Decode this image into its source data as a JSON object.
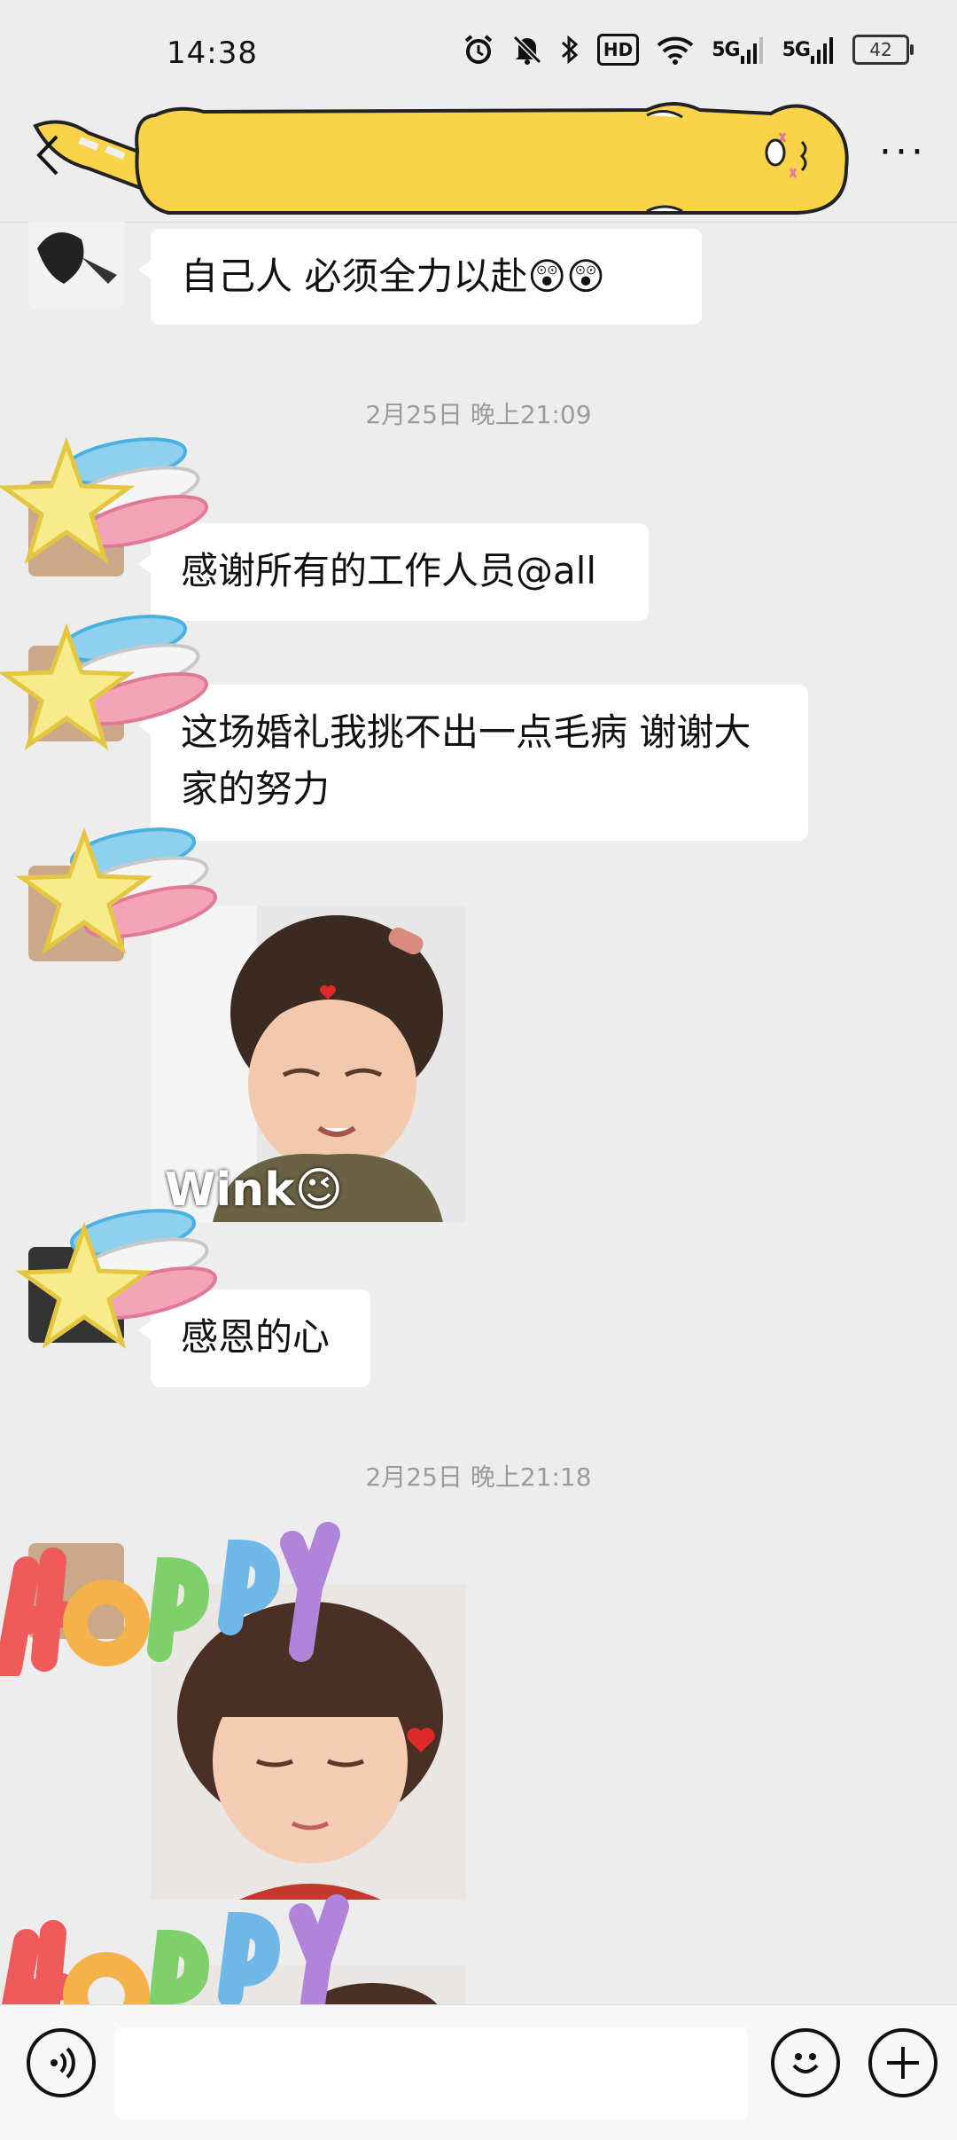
{
  "status_bar": {
    "time": "14:38",
    "icons": [
      "alarm-icon",
      "mute-icon",
      "bluetooth-icon",
      "hd-voice-icon",
      "wifi-icon",
      "5g-signal-icon",
      "5g-signal-icon"
    ],
    "hd_label": "HD",
    "signal1_label": "5G",
    "signal2_label": "5G",
    "battery": "42"
  },
  "header": {
    "back_icon": "chevron-left-icon",
    "more_icon": "more-icon",
    "more_glyph": "···",
    "title_sticker": "yellow-cat-banner",
    "cat_color": "#f9d449"
  },
  "messages": [
    {
      "type": "text",
      "text": "自己人  必须全力以赴😲😲"
    },
    {
      "type": "timestamp",
      "text": "2月25日 晚上21:09"
    },
    {
      "type": "text",
      "text": "感谢所有的工作人员@all"
    },
    {
      "type": "text",
      "text": "这场婚礼我挑不出一点毛病 谢谢大家的努力"
    },
    {
      "type": "sticker",
      "caption": "Wink😉"
    },
    {
      "type": "text",
      "text": "感恩的心"
    },
    {
      "type": "timestamp",
      "text": "2月25日 晚上21:18"
    },
    {
      "type": "sticker",
      "caption": ""
    }
  ],
  "input_bar": {
    "voice_icon": "voice-icon",
    "emoji_icon": "emoji-icon",
    "plus_icon": "plus-icon",
    "placeholder": ""
  }
}
